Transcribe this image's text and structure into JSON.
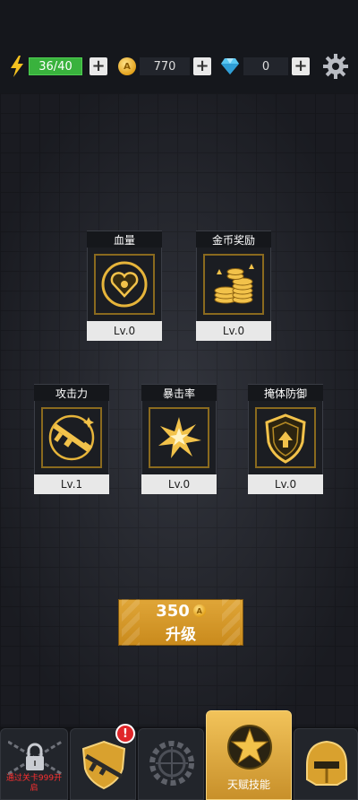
{
  "resources": {
    "energy": "36/40",
    "gold": "770",
    "diamonds": "0",
    "coin_symbol": "A",
    "plus": "+"
  },
  "skills": [
    {
      "name": "血量",
      "level": "Lv.0",
      "icon": "heart-icon"
    },
    {
      "name": "金币奖励",
      "level": "Lv.0",
      "icon": "coin-stack-icon"
    },
    {
      "name": "攻击力",
      "level": "Lv.1",
      "icon": "rifle-icon"
    },
    {
      "name": "暴击率",
      "level": "Lv.0",
      "icon": "explosion-icon"
    },
    {
      "name": "掩体防御",
      "level": "Lv.0",
      "icon": "shield-icon"
    }
  ],
  "upgrade": {
    "cost": "350",
    "label": "升级"
  },
  "nav": {
    "locked_text": "通过关卡999开启",
    "active_label": "天赋技能",
    "badge": "!"
  },
  "colors": {
    "gold_accent": "#e0a638",
    "energy_green": "#39b23d"
  }
}
